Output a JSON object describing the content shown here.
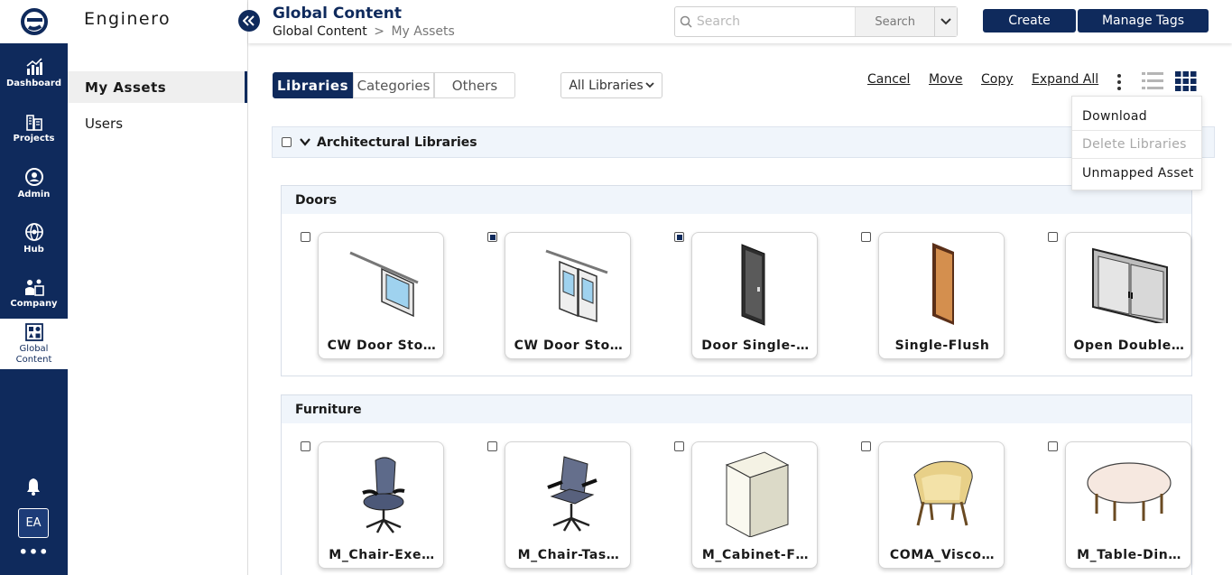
{
  "rail": {
    "items": [
      {
        "label": "Dashboard",
        "icon": "dashboard-chart-icon"
      },
      {
        "label": "Projects",
        "icon": "buildings-icon"
      },
      {
        "label": "Admin",
        "icon": "admin-user-icon"
      },
      {
        "label": "Hub",
        "icon": "hub-globe-icon"
      },
      {
        "label": "Company",
        "icon": "company-people-icon"
      },
      {
        "label": "Global Content",
        "icon": "global-content-icon"
      }
    ],
    "avatar_initials": "EA",
    "more_label": "•••"
  },
  "sidebar": {
    "brand": "Enginero",
    "items": [
      {
        "label": "My Assets",
        "active": true
      },
      {
        "label": "Users",
        "active": false
      }
    ]
  },
  "header": {
    "title": "Global Content",
    "breadcrumb": [
      "Global Content",
      "My Assets"
    ],
    "breadcrumb_sep": ">",
    "search_placeholder": "Search",
    "search_button": "Search",
    "create_label": "Create",
    "manage_tags_label": "Manage Tags"
  },
  "toolbar": {
    "tabs": [
      "Libraries",
      "Categories",
      "Others"
    ],
    "active_tab": "Libraries",
    "library_filter": "All Libraries",
    "actions": [
      "Cancel",
      "Move",
      "Copy",
      "Expand All"
    ],
    "menu": [
      {
        "label": "Download",
        "disabled": false
      },
      {
        "label": "Delete Libraries",
        "disabled": true
      },
      {
        "label": "Unmapped Asset",
        "disabled": false
      }
    ]
  },
  "library": {
    "title": "Architectural Libraries",
    "groups": [
      {
        "title": "Doors",
        "assets": [
          {
            "name": "CW Door Sto…",
            "checked": false,
            "thumb": "sliding-door-single"
          },
          {
            "name": "CW Door Sto…",
            "checked": true,
            "thumb": "sliding-door-double"
          },
          {
            "name": "Door Single-…",
            "checked": true,
            "thumb": "door-single-dark"
          },
          {
            "name": "Single-Flush",
            "checked": false,
            "thumb": "door-single-wood"
          },
          {
            "name": "Open Double…",
            "checked": false,
            "thumb": "door-double-open"
          }
        ]
      },
      {
        "title": "Furniture",
        "assets": [
          {
            "name": "M_Chair-Exe…",
            "checked": false,
            "thumb": "office-chair"
          },
          {
            "name": "M_Chair-Tas…",
            "checked": false,
            "thumb": "task-chair"
          },
          {
            "name": "M_Cabinet-F…",
            "checked": false,
            "thumb": "cabinet-box"
          },
          {
            "name": "COMA_Visco…",
            "checked": false,
            "thumb": "lounge-chair"
          },
          {
            "name": "M_Table-Din…",
            "checked": false,
            "thumb": "round-table"
          }
        ]
      }
    ]
  },
  "colors": {
    "brand_navy": "#0f2a5c",
    "panel_tint": "#f0f5fb"
  }
}
